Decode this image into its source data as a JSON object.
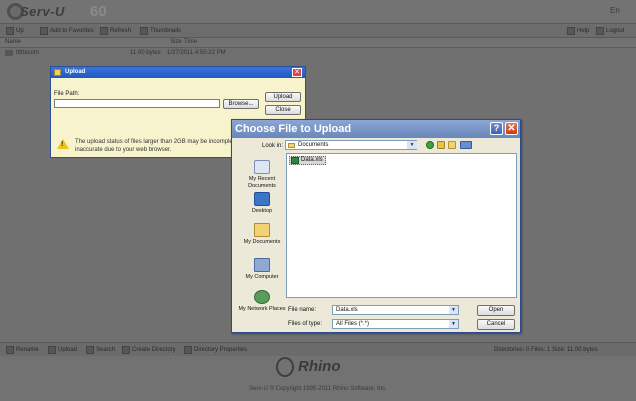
{
  "app": {
    "brand": "Serv-U",
    "brand_suffix": "60",
    "language": "En"
  },
  "toolbar": {
    "items": [
      {
        "label": "Up"
      },
      {
        "label": "Add to Favorites"
      },
      {
        "label": "Refresh"
      },
      {
        "label": "Thumbnails"
      },
      {
        "label": "Help"
      },
      {
        "label": "Logout"
      }
    ]
  },
  "file_list": {
    "columns": {
      "name": "Name",
      "size": "Size",
      "time": "Time"
    },
    "rows": [
      {
        "name": "tttttecom",
        "size": "11.00 bytes",
        "time": "1/27/2011 4:50:22 PM"
      }
    ]
  },
  "statusbar": {
    "items": [
      {
        "label": "Rename"
      },
      {
        "label": "Upload"
      },
      {
        "label": "Search"
      },
      {
        "label": "Create Directory"
      },
      {
        "label": "Directory Properties"
      }
    ],
    "summary": "Directories: 0    Files: 1    Size: 11.00 bytes"
  },
  "footer": {
    "brand": "Rhino",
    "copyright": "Serv-U ® Copyright 1995-2011 Rhino Software, Inc."
  },
  "upload_dialog": {
    "title": "Upload",
    "file_path_label": "File Path:",
    "file_path_value": "",
    "browse_label": "Browse...",
    "upload_label": "Upload",
    "close_label": "Close",
    "warning": "The upload status of files larger than 2GB may be incomplete a inaccurate due to your web browser."
  },
  "chooser": {
    "title": "Choose File to Upload",
    "look_in_label": "Look in:",
    "look_in_value": "Documents",
    "places": [
      {
        "label": "My Recent Documents",
        "icon": "recent-documents-icon"
      },
      {
        "label": "Desktop",
        "icon": "desktop-icon"
      },
      {
        "label": "My Documents",
        "icon": "my-documents-icon"
      },
      {
        "label": "My Computer",
        "icon": "my-computer-icon"
      },
      {
        "label": "My Network Places",
        "icon": "network-places-icon"
      }
    ],
    "files": [
      {
        "name": "Data.xls",
        "icon": "excel-file-icon",
        "selected": true
      }
    ],
    "file_name_label": "File name:",
    "file_name_value": "Data.xls",
    "file_type_label": "Files of type:",
    "file_type_value": "All Files (*.*)",
    "open_label": "Open",
    "cancel_label": "Cancel"
  }
}
